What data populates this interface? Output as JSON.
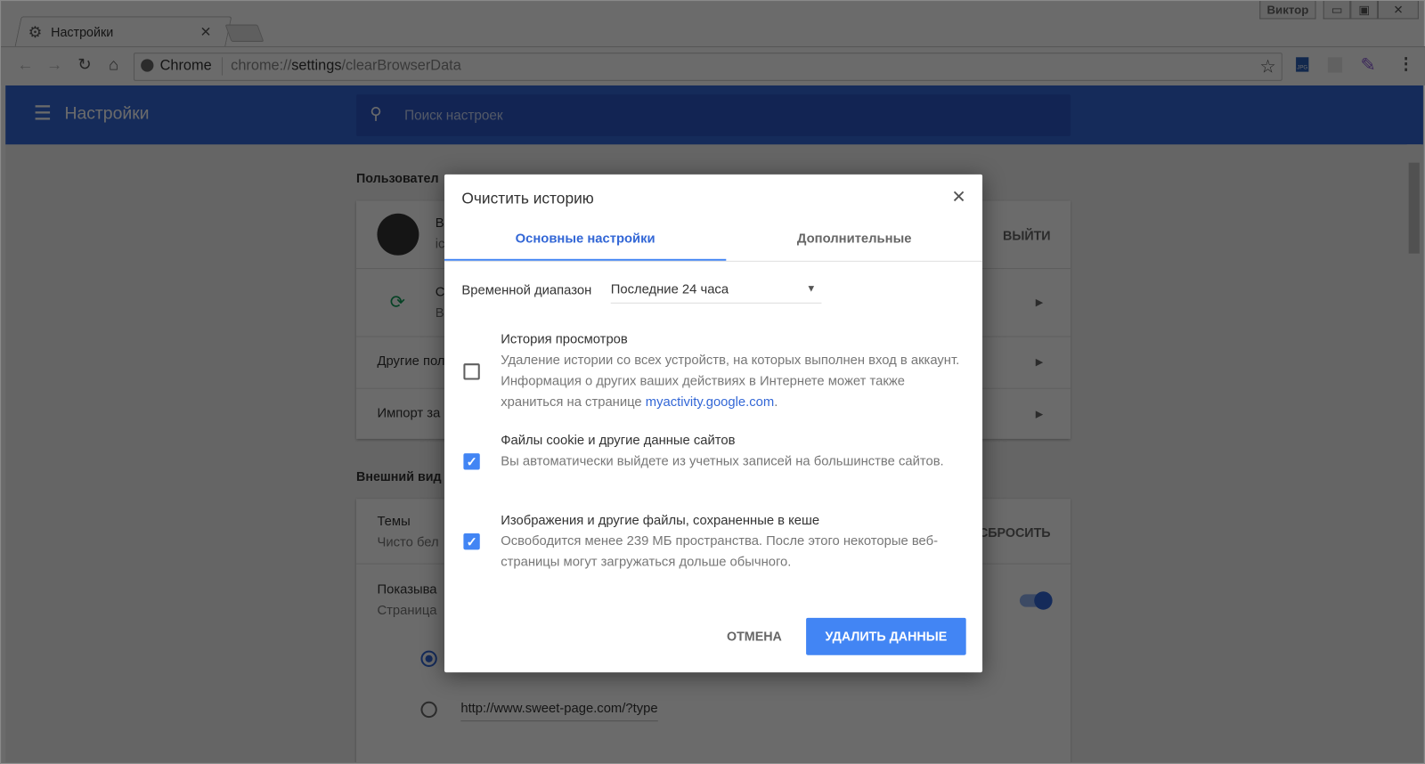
{
  "browser": {
    "tab_title": "Настройки",
    "tab_icon": "gear-icon",
    "profile_name": "Виктор",
    "omnibox": {
      "site_label": "Chrome",
      "url_prefix": "chrome://",
      "url_host": "settings",
      "url_path": "/clearBrowserData"
    }
  },
  "settings": {
    "header_title": "Настройки",
    "search_placeholder": "Поиск настроек",
    "people_section": "Пользовател",
    "user_name_partial": "В",
    "user_email_partial": "ic",
    "sign_out": "ВЫЙТИ",
    "sync_title_partial": "С",
    "sync_sub_partial": "В",
    "other_people_partial": "Другие пол",
    "import_partial": "Импорт за",
    "appearance_section": "Внешний вид",
    "themes_title": "Темы",
    "themes_sub_partial": "Чисто бел",
    "reset": "СБРОСИТЬ",
    "show_home_partial": "Показыва",
    "show_home_sub_partial": "Страница",
    "home_toggle_on": true,
    "radio_url": "http://www.sweet-page.com/?type",
    "radio_selected_index": 0
  },
  "dialog": {
    "title": "Очистить историю",
    "tabs": [
      {
        "label": "Основные настройки",
        "active": true
      },
      {
        "label": "Дополнительные",
        "active": false
      }
    ],
    "range_label": "Временной диапазон",
    "range_value": "Последние 24 часа",
    "items": [
      {
        "title": "История просмотров",
        "desc": "Удаление истории со всех устройств, на которых выполнен вход в аккаунт. Информация о других ваших действиях в Интернете может также храниться на странице ",
        "link": "myactivity.google.com",
        "desc_end": ".",
        "checked": false
      },
      {
        "title": "Файлы cookie и другие данные сайтов",
        "desc": "Вы автоматически выйдете из учетных записей на большинстве сайтов.",
        "checked": true
      },
      {
        "title": "Изображения и другие файлы, сохраненные в кеше",
        "desc": "Освободится менее 239 МБ пространства. После этого некоторые веб-страницы могут загружаться дольше обычного.",
        "checked": true
      }
    ],
    "cancel": "ОТМЕНА",
    "confirm": "УДАЛИТЬ ДАННЫЕ"
  },
  "colors": {
    "accent": "#4285f4",
    "header": "#3367d6",
    "link": "#3367d6"
  }
}
